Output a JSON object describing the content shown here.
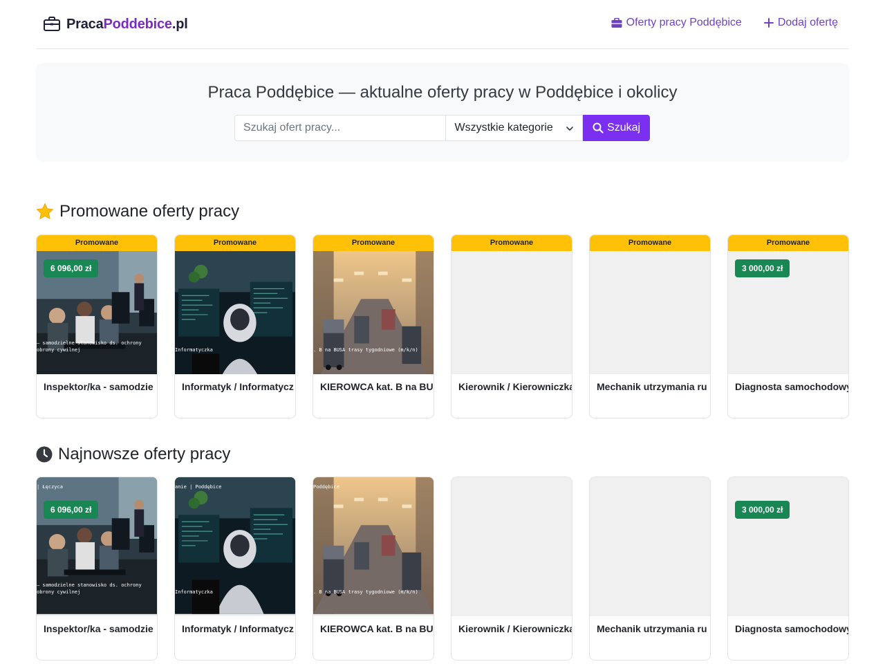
{
  "brand": {
    "part1": "Praca",
    "part2": "Poddebice",
    "part3": ".pl"
  },
  "nav": {
    "offers_label": "Oferty pracy Poddębice",
    "add_label": "Dodaj ofertę"
  },
  "hero": {
    "title": "Praca Poddębice — aktualne oferty pracy w Poddębice i okolicy",
    "search_placeholder": "Szukaj ofert pracy...",
    "category_selected": "Wszystkie kategorie",
    "search_button": "Szukaj"
  },
  "promoted": {
    "title": "Promowane oferty pracy",
    "badge": "Promowane",
    "cards": [
      {
        "title": "Inspektor/ka - samodzie",
        "salary": "6 096,00 zł",
        "image": "office",
        "caption1": "– samodzielne stanowisko ds. ochrony",
        "caption2": "obrony cywilnej",
        "top_caption": ""
      },
      {
        "title": "Informatyk / Informatycz",
        "salary": "",
        "image": "coder",
        "caption1": "Informatyczka",
        "caption2": "",
        "top_caption": ""
      },
      {
        "title": "KIEROWCA kat. B na BUS",
        "salary": "",
        "image": "road",
        "caption1": ". B na BUSA trasy tygodniowe (m/k/n)",
        "caption2": "",
        "top_caption": ""
      },
      {
        "title": "Kierownik / Kierowniczka",
        "salary": "",
        "image": "blank",
        "caption1": "",
        "caption2": "",
        "top_caption": ""
      },
      {
        "title": "Mechanik utrzymania ru",
        "salary": "",
        "image": "blank",
        "caption1": "",
        "caption2": "",
        "top_caption": ""
      },
      {
        "title": "Diagnosta samochodowy",
        "salary": "3 000,00 zł",
        "image": "blank",
        "caption1": "",
        "caption2": "",
        "top_caption": ""
      }
    ]
  },
  "newest": {
    "title": "Najnowsze oferty pracy",
    "cards": [
      {
        "title": "Inspektor/ka - samodzie",
        "salary": "6 096,00 zł",
        "image": "office",
        "caption1": "– samodzielne stanowisko ds. ochrony",
        "caption2": "obrony cywilnej",
        "top_caption": "|  Łęczyca"
      },
      {
        "title": "Informatyk / Informatycz",
        "salary": "",
        "image": "coder",
        "caption1": "Informatyczka",
        "caption2": "",
        "top_caption": "anie  |  Poddębice"
      },
      {
        "title": "KIEROWCA kat. B na BUS",
        "salary": "",
        "image": "road",
        "caption1": ". B na BUSA trasy tygodniowe (m/k/n)",
        "caption2": "",
        "top_caption": "Poddębice"
      },
      {
        "title": "Kierownik / Kierowniczka",
        "salary": "",
        "image": "blank",
        "caption1": "",
        "caption2": "",
        "top_caption": ""
      },
      {
        "title": "Mechanik utrzymania ru",
        "salary": "",
        "image": "blank",
        "caption1": "",
        "caption2": "",
        "top_caption": ""
      },
      {
        "title": "Diagnosta samochodowy",
        "salary": "3 000,00 zł",
        "image": "blank",
        "caption1": "",
        "caption2": "",
        "top_caption": ""
      }
    ]
  },
  "colors": {
    "accent": "#7b2ff0",
    "link": "#6f42c1",
    "promo_badge": "#ffc107",
    "salary_badge": "#198754"
  },
  "icons": {
    "brand": "briefcase-outline-icon",
    "nav_offers": "briefcase-icon",
    "nav_add": "plus-icon",
    "search": "search-icon",
    "promoted": "star-icon",
    "newest": "clock-icon"
  }
}
